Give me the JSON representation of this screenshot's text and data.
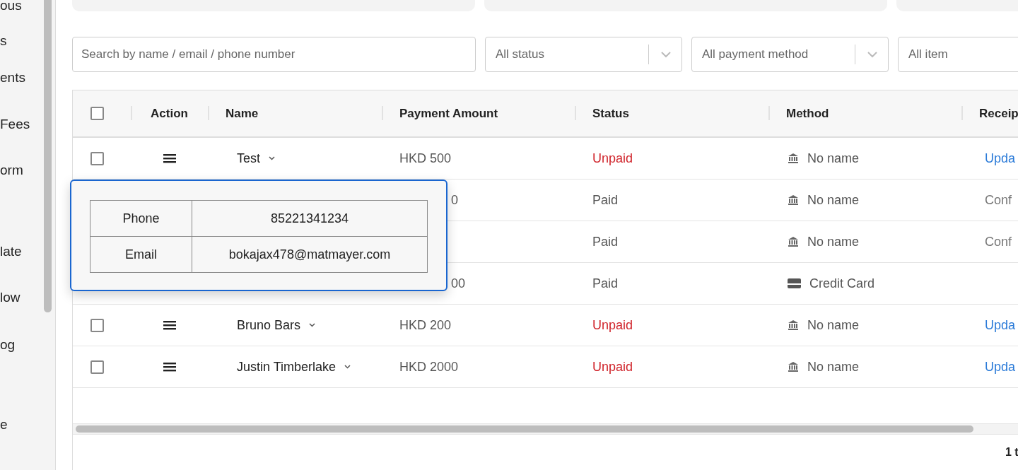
{
  "sidebar": {
    "items": [
      "ous",
      "s",
      "ents",
      "Fees",
      "orm",
      "late",
      "low",
      "og",
      "e"
    ]
  },
  "filters": {
    "search": {
      "placeholder": "Search by name / email / phone number"
    },
    "selects": [
      "All status",
      "All payment method",
      "All item"
    ]
  },
  "table": {
    "select_all": {
      "checked": false
    },
    "columns": [
      "Action",
      "Name",
      "Payment Amount",
      "Status",
      "Method",
      "Receip"
    ],
    "rows": [
      {
        "checked": false,
        "name": "Test",
        "amount": "HKD 500",
        "status": {
          "text": "Unpaid",
          "color": "#d0232a"
        },
        "method": {
          "kind": "bank",
          "text": "No name"
        },
        "receipt": {
          "kind": "link",
          "text": "Upda"
        }
      },
      {
        "amount": "0",
        "status": {
          "text": "Paid",
          "color": "#555555"
        },
        "method": {
          "kind": "bank",
          "text": "No name"
        },
        "receipt": {
          "kind": "text",
          "text": "Conf"
        }
      },
      {
        "status": {
          "text": "Paid",
          "color": "#555555"
        },
        "method": {
          "kind": "bank",
          "text": "No name"
        },
        "receipt": {
          "kind": "text",
          "text": "Conf"
        }
      },
      {
        "amount": "00",
        "status": {
          "text": "Paid",
          "color": "#555555"
        },
        "method": {
          "kind": "card",
          "text": "Credit Card"
        }
      },
      {
        "checked": false,
        "name": "Bruno Bars",
        "amount": "HKD 200",
        "status": {
          "text": "Unpaid",
          "color": "#d0232a"
        },
        "method": {
          "kind": "bank",
          "text": "No name"
        },
        "receipt": {
          "kind": "link",
          "text": "Upda"
        }
      },
      {
        "checked": false,
        "name": "Justin Timberlake",
        "amount": "HKD 2000",
        "status": {
          "text": "Unpaid",
          "color": "#d0232a"
        },
        "method": {
          "kind": "bank",
          "text": "No name"
        },
        "receipt": {
          "kind": "link",
          "text": "Upda"
        }
      }
    ]
  },
  "popup": {
    "rows": [
      {
        "label": "Phone",
        "value": "85221341234"
      },
      {
        "label": "Email",
        "value": "bokajax478@matmayer.com"
      }
    ]
  },
  "footer": {
    "text": "1 t"
  }
}
